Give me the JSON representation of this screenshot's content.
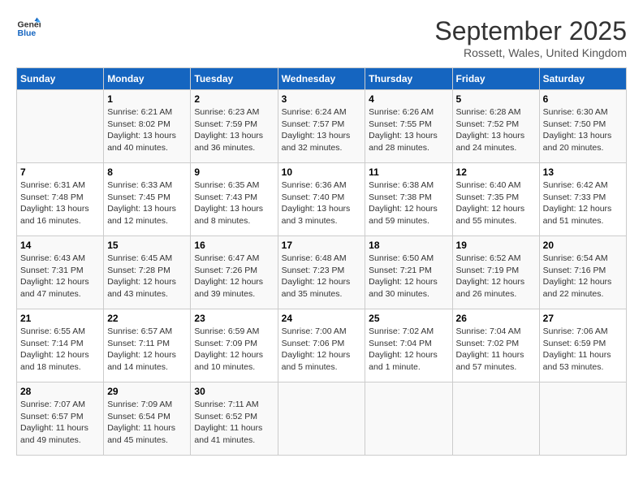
{
  "header": {
    "logo_line1": "General",
    "logo_line2": "Blue",
    "month": "September 2025",
    "location": "Rossett, Wales, United Kingdom"
  },
  "weekdays": [
    "Sunday",
    "Monday",
    "Tuesday",
    "Wednesday",
    "Thursday",
    "Friday",
    "Saturday"
  ],
  "weeks": [
    [
      null,
      {
        "day": 1,
        "sunrise": "6:21 AM",
        "sunset": "8:02 PM",
        "daylight": "13 hours and 40 minutes."
      },
      {
        "day": 2,
        "sunrise": "6:23 AM",
        "sunset": "7:59 PM",
        "daylight": "13 hours and 36 minutes."
      },
      {
        "day": 3,
        "sunrise": "6:24 AM",
        "sunset": "7:57 PM",
        "daylight": "13 hours and 32 minutes."
      },
      {
        "day": 4,
        "sunrise": "6:26 AM",
        "sunset": "7:55 PM",
        "daylight": "13 hours and 28 minutes."
      },
      {
        "day": 5,
        "sunrise": "6:28 AM",
        "sunset": "7:52 PM",
        "daylight": "13 hours and 24 minutes."
      },
      {
        "day": 6,
        "sunrise": "6:30 AM",
        "sunset": "7:50 PM",
        "daylight": "13 hours and 20 minutes."
      }
    ],
    [
      {
        "day": 7,
        "sunrise": "6:31 AM",
        "sunset": "7:48 PM",
        "daylight": "13 hours and 16 minutes."
      },
      {
        "day": 8,
        "sunrise": "6:33 AM",
        "sunset": "7:45 PM",
        "daylight": "13 hours and 12 minutes."
      },
      {
        "day": 9,
        "sunrise": "6:35 AM",
        "sunset": "7:43 PM",
        "daylight": "13 hours and 8 minutes."
      },
      {
        "day": 10,
        "sunrise": "6:36 AM",
        "sunset": "7:40 PM",
        "daylight": "13 hours and 3 minutes."
      },
      {
        "day": 11,
        "sunrise": "6:38 AM",
        "sunset": "7:38 PM",
        "daylight": "12 hours and 59 minutes."
      },
      {
        "day": 12,
        "sunrise": "6:40 AM",
        "sunset": "7:35 PM",
        "daylight": "12 hours and 55 minutes."
      },
      {
        "day": 13,
        "sunrise": "6:42 AM",
        "sunset": "7:33 PM",
        "daylight": "12 hours and 51 minutes."
      }
    ],
    [
      {
        "day": 14,
        "sunrise": "6:43 AM",
        "sunset": "7:31 PM",
        "daylight": "12 hours and 47 minutes."
      },
      {
        "day": 15,
        "sunrise": "6:45 AM",
        "sunset": "7:28 PM",
        "daylight": "12 hours and 43 minutes."
      },
      {
        "day": 16,
        "sunrise": "6:47 AM",
        "sunset": "7:26 PM",
        "daylight": "12 hours and 39 minutes."
      },
      {
        "day": 17,
        "sunrise": "6:48 AM",
        "sunset": "7:23 PM",
        "daylight": "12 hours and 35 minutes."
      },
      {
        "day": 18,
        "sunrise": "6:50 AM",
        "sunset": "7:21 PM",
        "daylight": "12 hours and 30 minutes."
      },
      {
        "day": 19,
        "sunrise": "6:52 AM",
        "sunset": "7:19 PM",
        "daylight": "12 hours and 26 minutes."
      },
      {
        "day": 20,
        "sunrise": "6:54 AM",
        "sunset": "7:16 PM",
        "daylight": "12 hours and 22 minutes."
      }
    ],
    [
      {
        "day": 21,
        "sunrise": "6:55 AM",
        "sunset": "7:14 PM",
        "daylight": "12 hours and 18 minutes."
      },
      {
        "day": 22,
        "sunrise": "6:57 AM",
        "sunset": "7:11 PM",
        "daylight": "12 hours and 14 minutes."
      },
      {
        "day": 23,
        "sunrise": "6:59 AM",
        "sunset": "7:09 PM",
        "daylight": "12 hours and 10 minutes."
      },
      {
        "day": 24,
        "sunrise": "7:00 AM",
        "sunset": "7:06 PM",
        "daylight": "12 hours and 5 minutes."
      },
      {
        "day": 25,
        "sunrise": "7:02 AM",
        "sunset": "7:04 PM",
        "daylight": "12 hours and 1 minute."
      },
      {
        "day": 26,
        "sunrise": "7:04 AM",
        "sunset": "7:02 PM",
        "daylight": "11 hours and 57 minutes."
      },
      {
        "day": 27,
        "sunrise": "7:06 AM",
        "sunset": "6:59 PM",
        "daylight": "11 hours and 53 minutes."
      }
    ],
    [
      {
        "day": 28,
        "sunrise": "7:07 AM",
        "sunset": "6:57 PM",
        "daylight": "11 hours and 49 minutes."
      },
      {
        "day": 29,
        "sunrise": "7:09 AM",
        "sunset": "6:54 PM",
        "daylight": "11 hours and 45 minutes."
      },
      {
        "day": 30,
        "sunrise": "7:11 AM",
        "sunset": "6:52 PM",
        "daylight": "11 hours and 41 minutes."
      },
      null,
      null,
      null,
      null
    ]
  ]
}
